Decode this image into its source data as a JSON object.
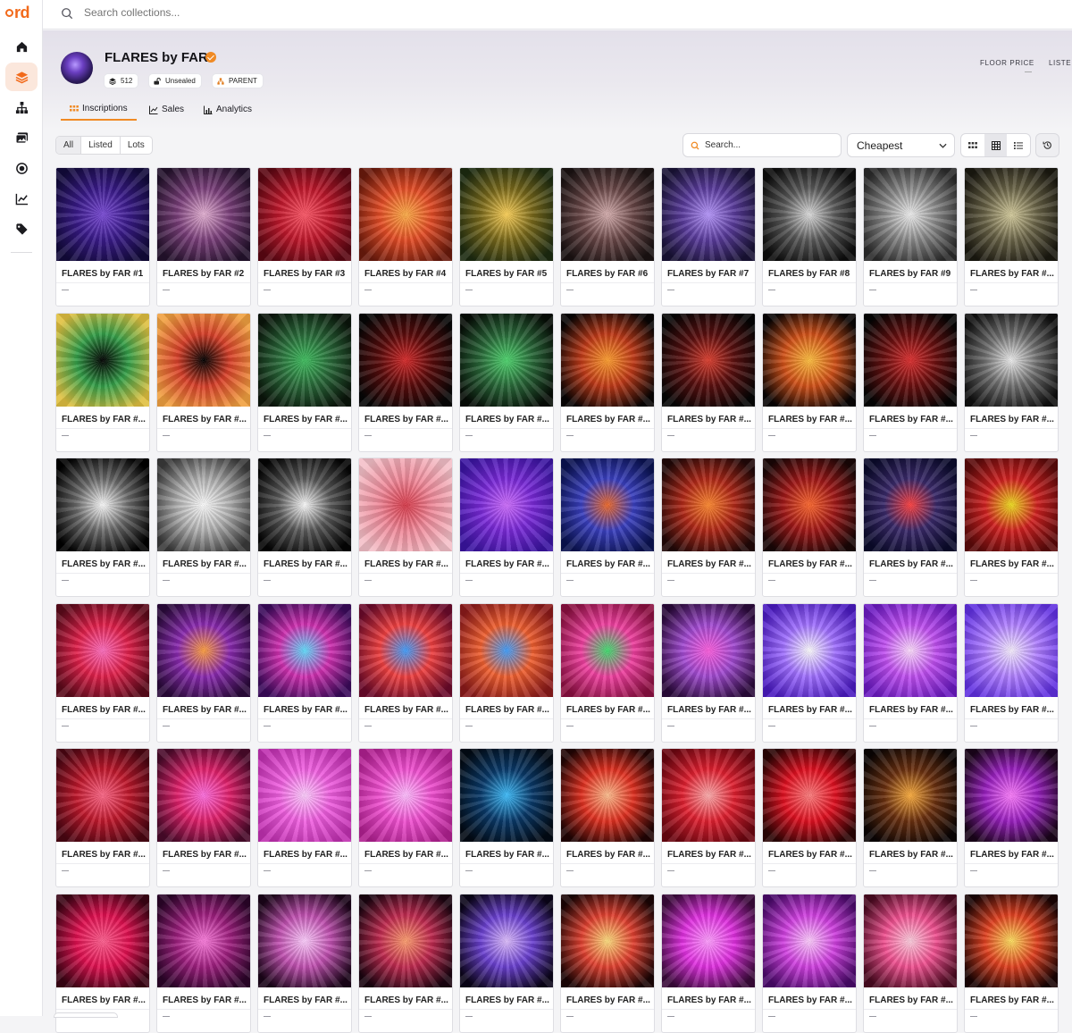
{
  "app": {
    "logo_text": "rd",
    "brand_color": "#f26a1b"
  },
  "topbar": {
    "search_placeholder": "Search collections..."
  },
  "sidebar": {
    "items": [
      {
        "name": "home",
        "icon": "home-icon",
        "active": false
      },
      {
        "name": "collections",
        "icon": "layers-icon",
        "active": true
      },
      {
        "name": "parents",
        "icon": "hierarchy-icon",
        "active": false
      },
      {
        "name": "gallery",
        "icon": "images-icon",
        "active": false
      },
      {
        "name": "ordinals",
        "icon": "target-icon",
        "active": false
      },
      {
        "name": "charts",
        "icon": "chart-icon",
        "active": false
      },
      {
        "name": "tags",
        "icon": "tag-icon",
        "active": false
      }
    ]
  },
  "collection": {
    "title": "FLARES by FAR",
    "verified": true,
    "badges": [
      {
        "label": "512",
        "icon": "stack-icon"
      },
      {
        "label": "Unsealed",
        "icon": "unlock-icon"
      },
      {
        "label": "PARENT",
        "icon": "parent-icon"
      }
    ],
    "stats": [
      "FLOOR PRICE",
      "LISTE"
    ]
  },
  "tabs": [
    {
      "label": "Inscriptions",
      "icon": "grid-dots-icon",
      "active": true
    },
    {
      "label": "Sales",
      "icon": "line-chart-icon",
      "active": false
    },
    {
      "label": "Analytics",
      "icon": "bar-chart-icon",
      "active": false
    }
  ],
  "filters": [
    {
      "label": "All",
      "active": true
    },
    {
      "label": "Listed",
      "active": false
    },
    {
      "label": "Lots",
      "active": false
    }
  ],
  "list_search": {
    "placeholder": "Search..."
  },
  "sort": {
    "selected": "Cheapest"
  },
  "views": [
    {
      "icon": "small-grid-icon",
      "active": false
    },
    {
      "icon": "large-grid-icon",
      "active": true
    },
    {
      "icon": "list-view-icon",
      "active": false
    }
  ],
  "items": [
    {
      "name": "FLARES by FAR #1",
      "price": "—",
      "art": [
        "#7c4dd8",
        "#3a1b8a",
        "#120a3a"
      ]
    },
    {
      "name": "FLARES by FAR #2",
      "price": "—",
      "art": [
        "#e7b4d6",
        "#7a3f7a",
        "#24122c"
      ]
    },
    {
      "name": "FLARES by FAR #3",
      "price": "—",
      "art": [
        "#ff5a6a",
        "#c0182c",
        "#5a0712"
      ]
    },
    {
      "name": "FLARES by FAR #4",
      "price": "—",
      "art": [
        "#ffb04a",
        "#e34c26",
        "#6a1a0c"
      ]
    },
    {
      "name": "FLARES by FAR #5",
      "price": "—",
      "art": [
        "#ffd35a",
        "#7a6a1c",
        "#1c2a10"
      ]
    },
    {
      "name": "FLARES by FAR #6",
      "price": "—",
      "art": [
        "#d9b2b2",
        "#6a4848",
        "#1a1212"
      ]
    },
    {
      "name": "FLARES by FAR #7",
      "price": "—",
      "art": [
        "#b99aff",
        "#5a3c9c",
        "#181234"
      ]
    },
    {
      "name": "FLARES by FAR #8",
      "price": "—",
      "art": [
        "#e0e0e0",
        "#5a5a5a",
        "#0c0c0c"
      ]
    },
    {
      "name": "FLARES by FAR #9",
      "price": "—",
      "art": [
        "#f2f2f2",
        "#8a8a8a",
        "#2a2a2a"
      ]
    },
    {
      "name": "FLARES by FAR #...",
      "price": "—",
      "art": [
        "#d8cfa0",
        "#6a6448",
        "#1a1810"
      ]
    },
    {
      "name": "FLARES by FAR #...",
      "price": "—",
      "art": [
        "#000000",
        "#35a04a",
        "#e0c040"
      ]
    },
    {
      "name": "FLARES by FAR #...",
      "price": "—",
      "art": [
        "#000000",
        "#d8402a",
        "#f0a040"
      ]
    },
    {
      "name": "FLARES by FAR #...",
      "price": "—",
      "art": [
        "#40c060",
        "#2a6a3a",
        "#0a140a"
      ]
    },
    {
      "name": "FLARES by FAR #...",
      "price": "—",
      "art": [
        "#d82a2a",
        "#5a0c0c",
        "#060606"
      ]
    },
    {
      "name": "FLARES by FAR #...",
      "price": "—",
      "art": [
        "#50d870",
        "#2a6a3a",
        "#060c06"
      ]
    },
    {
      "name": "FLARES by FAR #...",
      "price": "—",
      "art": [
        "#ffa030",
        "#c03a18",
        "#080404"
      ]
    },
    {
      "name": "FLARES by FAR #...",
      "price": "—",
      "art": [
        "#e04030",
        "#5a1010",
        "#040404"
      ]
    },
    {
      "name": "FLARES by FAR #...",
      "price": "—",
      "art": [
        "#ffc040",
        "#d05018",
        "#080404"
      ]
    },
    {
      "name": "FLARES by FAR #...",
      "price": "—",
      "art": [
        "#e03030",
        "#6a1010",
        "#040404"
      ]
    },
    {
      "name": "FLARES by FAR #...",
      "price": "—",
      "art": [
        "#f0f0f0",
        "#707070",
        "#101010"
      ]
    },
    {
      "name": "FLARES by FAR #...",
      "price": "—",
      "art": [
        "#ffffff",
        "#6a6a6a",
        "#000000"
      ]
    },
    {
      "name": "FLARES by FAR #...",
      "price": "—",
      "art": [
        "#ffffff",
        "#b0b0b0",
        "#3a3a3a"
      ]
    },
    {
      "name": "FLARES by FAR #...",
      "price": "—",
      "art": [
        "#ffffff",
        "#5a5a5a",
        "#050505"
      ]
    },
    {
      "name": "FLARES by FAR #...",
      "price": "—",
      "art": [
        "#d83a4a",
        "#f08a9a",
        "#f4c0c8"
      ]
    },
    {
      "name": "FLARES by FAR #...",
      "price": "—",
      "art": [
        "#d070ff",
        "#7a2ad8",
        "#3a14a0"
      ]
    },
    {
      "name": "FLARES by FAR #...",
      "price": "—",
      "art": [
        "#f06a2a",
        "#3a40c0",
        "#0a1250"
      ]
    },
    {
      "name": "FLARES by FAR #...",
      "price": "—",
      "art": [
        "#ff8a30",
        "#b02818",
        "#200808"
      ]
    },
    {
      "name": "FLARES by FAR #...",
      "price": "—",
      "art": [
        "#ff6a30",
        "#a01818",
        "#180606"
      ]
    },
    {
      "name": "FLARES by FAR #...",
      "price": "—",
      "art": [
        "#ff4040",
        "#3a2a6a",
        "#0a0a2a"
      ]
    },
    {
      "name": "FLARES by FAR #...",
      "price": "—",
      "art": [
        "#f0e020",
        "#d02020",
        "#5a0a0a"
      ]
    },
    {
      "name": "FLARES by FAR #...",
      "price": "—",
      "art": [
        "#ff70c0",
        "#e0204a",
        "#5a0a1a"
      ]
    },
    {
      "name": "FLARES by FAR #...",
      "price": "—",
      "art": [
        "#ffa040",
        "#8a2ab0",
        "#2a0a3a"
      ]
    },
    {
      "name": "FLARES by FAR #...",
      "price": "—",
      "art": [
        "#60e0ff",
        "#d030b0",
        "#3a0a5a"
      ]
    },
    {
      "name": "FLARES by FAR #...",
      "price": "—",
      "art": [
        "#40a0ff",
        "#f04040",
        "#6a0a2a"
      ]
    },
    {
      "name": "FLARES by FAR #...",
      "price": "—",
      "art": [
        "#40a0ff",
        "#f06030",
        "#8a1a1a"
      ]
    },
    {
      "name": "FLARES by FAR #...",
      "price": "—",
      "art": [
        "#40e070",
        "#f040a0",
        "#8a1040"
      ]
    },
    {
      "name": "FLARES by FAR #...",
      "price": "—",
      "art": [
        "#ff60e0",
        "#a04ad0",
        "#2a0a3a"
      ]
    },
    {
      "name": "FLARES by FAR #...",
      "price": "—",
      "art": [
        "#ffffff",
        "#a070ff",
        "#4a1ac0"
      ]
    },
    {
      "name": "FLARES by FAR #...",
      "price": "—",
      "art": [
        "#ffe0ff",
        "#c050f0",
        "#6a1ac0"
      ]
    },
    {
      "name": "FLARES by FAR #...",
      "price": "—",
      "art": [
        "#f8f0ff",
        "#b080ff",
        "#6030e0"
      ]
    },
    {
      "name": "FLARES by FAR #...",
      "price": "—",
      "art": [
        "#ff6a8a",
        "#c0182c",
        "#4a0612"
      ]
    },
    {
      "name": "FLARES by FAR #...",
      "price": "—",
      "art": [
        "#ff70e0",
        "#e0206a",
        "#4a0a2a"
      ]
    },
    {
      "name": "FLARES by FAR #...",
      "price": "—",
      "art": [
        "#ffd0ff",
        "#f060e0",
        "#c030b0"
      ]
    },
    {
      "name": "FLARES by FAR #...",
      "price": "—",
      "art": [
        "#ffc0ff",
        "#f050d0",
        "#b02090"
      ]
    },
    {
      "name": "FLARES by FAR #...",
      "price": "—",
      "art": [
        "#40c0ff",
        "#0a3a6a",
        "#020a14"
      ]
    },
    {
      "name": "FLARES by FAR #...",
      "price": "—",
      "art": [
        "#ffc090",
        "#e03020",
        "#200404"
      ]
    },
    {
      "name": "FLARES by FAR #...",
      "price": "—",
      "art": [
        "#ffb0b0",
        "#e02030",
        "#6a0610"
      ]
    },
    {
      "name": "FLARES by FAR #...",
      "price": "—",
      "art": [
        "#ff8080",
        "#e01020",
        "#2a0404"
      ]
    },
    {
      "name": "FLARES by FAR #...",
      "price": "—",
      "art": [
        "#ffb040",
        "#6a3010",
        "#0a0404"
      ]
    },
    {
      "name": "FLARES by FAR #...",
      "price": "—",
      "art": [
        "#ff80ff",
        "#9a20c0",
        "#1a041a"
      ]
    },
    {
      "name": "FLARES by FAR #...",
      "price": "—",
      "art": [
        "#ff6090",
        "#e01050",
        "#3a0414"
      ]
    },
    {
      "name": "FLARES by FAR #...",
      "price": "—",
      "art": [
        "#ff80e0",
        "#a02080",
        "#2a0428"
      ]
    },
    {
      "name": "FLARES by FAR #...",
      "price": "—",
      "art": [
        "#ffd0ff",
        "#c050b0",
        "#1a0418"
      ]
    },
    {
      "name": "FLARES by FAR #...",
      "price": "—",
      "art": [
        "#ffa070",
        "#c02a50",
        "#1a0410"
      ]
    },
    {
      "name": "FLARES by FAR #...",
      "price": "—",
      "art": [
        "#e0c0ff",
        "#6a40d0",
        "#0a0418"
      ]
    },
    {
      "name": "FLARES by FAR #...",
      "price": "—",
      "art": [
        "#ffe080",
        "#e04030",
        "#1a0404"
      ]
    },
    {
      "name": "FLARES by FAR #...",
      "price": "—",
      "art": [
        "#ffa0ff",
        "#e030e0",
        "#3a0a3a"
      ]
    },
    {
      "name": "FLARES by FAR #...",
      "price": "—",
      "art": [
        "#ffd0ff",
        "#d040e0",
        "#4a0a6a"
      ]
    },
    {
      "name": "FLARES by FAR #...",
      "price": "—",
      "art": [
        "#ffd0e0",
        "#f05090",
        "#4a0a20"
      ]
    },
    {
      "name": "FLARES by FAR #...",
      "price": "—",
      "art": [
        "#ffe060",
        "#e04020",
        "#1a0404"
      ]
    }
  ]
}
